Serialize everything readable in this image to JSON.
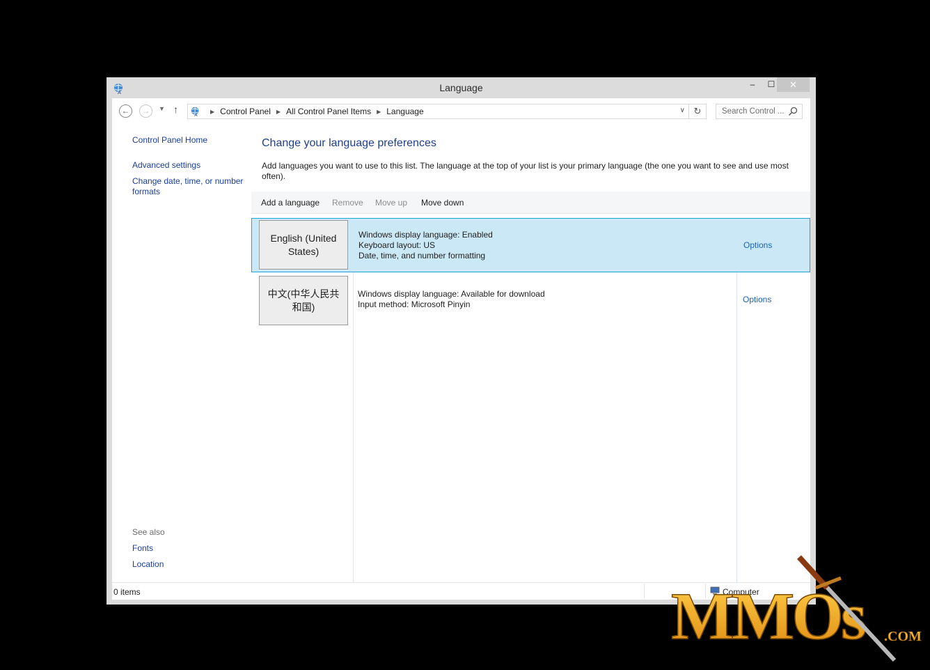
{
  "window": {
    "title": "Language",
    "minimize": "–",
    "maximize": "☐",
    "close": "✕"
  },
  "nav": {
    "back_icon": "←",
    "forward_icon": "→",
    "history_icon": "▼",
    "up_icon": "↑",
    "breadcrumbs": [
      "Control Panel",
      "All Control Panel Items",
      "Language"
    ],
    "breadcrumb_sep": "▶",
    "dropdown_icon": "∨",
    "refresh_icon": "↻",
    "search_placeholder": "Search Control ..."
  },
  "sidebar": {
    "home": "Control Panel Home",
    "advanced": "Advanced settings",
    "date_formats": "Change date, time, or number formats",
    "see_also": "See also",
    "fonts": "Fonts",
    "location": "Location"
  },
  "main": {
    "heading": "Change your language preferences",
    "description": "Add languages you want to use to this list. The language at the top of your list is your primary language (the one you want to see and use most often).",
    "toolbar": {
      "add": "Add a language",
      "remove": "Remove",
      "move_up": "Move up",
      "move_down": "Move down"
    },
    "languages": [
      {
        "name": "English (United States)",
        "selected": true,
        "details": [
          "Windows display language: Enabled",
          "Keyboard layout: US",
          "Date, time, and number formatting"
        ],
        "options": "Options"
      },
      {
        "name": "中文(中华人民共和国)",
        "selected": false,
        "details": [
          "Windows display language: Available for download",
          "Input method: Microsoft Pinyin"
        ],
        "options": "Options"
      }
    ]
  },
  "status": {
    "items": "0 items",
    "computer": "Computer"
  },
  "watermark": {
    "text": "MMOs",
    "suffix": ".COM"
  },
  "colors": {
    "link": "#1a3e9c",
    "heading": "#1e3f8f",
    "selection_bg": "#cbe8f6",
    "selection_border": "#26a0da",
    "watermark_gold": "#f2b21a"
  },
  "icons": {
    "title": "language-icon",
    "address": "language-icon",
    "search": "magnifier-icon",
    "status": "computer-icon"
  }
}
